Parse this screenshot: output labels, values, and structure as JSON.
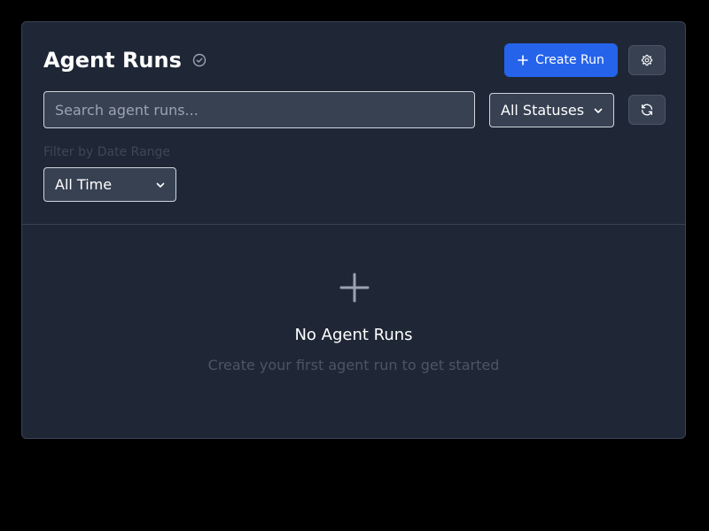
{
  "header": {
    "title": "Agent Runs",
    "title_icon": "check-circle-icon",
    "create_button_label": "Create Run",
    "create_button_icon": "plus-icon",
    "settings_icon": "gear-icon",
    "refresh_icon": "refresh-icon"
  },
  "filters": {
    "search_placeholder": "Search agent runs...",
    "search_value": "",
    "status_selected": "All Statuses",
    "date_label": "Filter by Date Range",
    "date_selected": "All Time"
  },
  "empty_state": {
    "icon": "plus-icon",
    "title": "No Agent Runs",
    "subtitle": "Create your first agent run to get started"
  },
  "colors": {
    "page_background": "#000000",
    "panel_background": "#1f2737",
    "accent": "#2563eb",
    "muted_text": "#4b5563"
  }
}
